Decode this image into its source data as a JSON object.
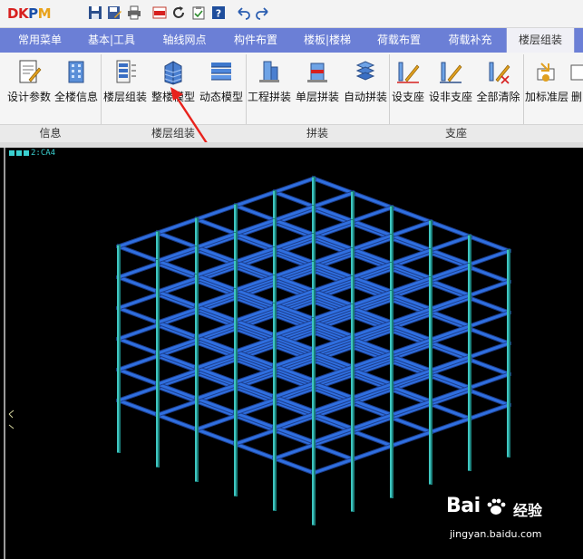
{
  "app": {
    "logo_text": [
      "DK",
      "P",
      "M"
    ],
    "quick_access": [
      "save-icon",
      "save-as-icon",
      "print-icon",
      "dwg-icon",
      "refresh-icon",
      "clipboard-icon",
      "help-icon",
      "undo-icon",
      "redo-icon"
    ]
  },
  "tabs": [
    {
      "label": "常用菜单",
      "active": false
    },
    {
      "label": "基本|工具",
      "active": false
    },
    {
      "label": "轴线网点",
      "active": false
    },
    {
      "label": "构件布置",
      "active": false
    },
    {
      "label": "楼板|楼梯",
      "active": false
    },
    {
      "label": "荷载布置",
      "active": false
    },
    {
      "label": "荷载补充",
      "active": false
    },
    {
      "label": "楼层组装",
      "active": true
    }
  ],
  "ribbon": {
    "buttons": [
      {
        "label": "设计参数",
        "icon": "design-params-icon"
      },
      {
        "label": "全楼信息",
        "icon": "building-info-icon"
      },
      {
        "label": "楼层组装",
        "icon": "floor-assembly-icon"
      },
      {
        "label": "整楼模型",
        "icon": "whole-building-model-icon"
      },
      {
        "label": "动态模型",
        "icon": "dynamic-model-icon"
      },
      {
        "label": "工程拼装",
        "icon": "project-splice-icon"
      },
      {
        "label": "单层拼装",
        "icon": "single-floor-splice-icon"
      },
      {
        "label": "自动拼装",
        "icon": "auto-splice-icon"
      },
      {
        "label": "设支座",
        "icon": "set-support-icon"
      },
      {
        "label": "设非支座",
        "icon": "set-non-support-icon"
      },
      {
        "label": "全部清除",
        "icon": "clear-all-icon"
      },
      {
        "label": "加标准层",
        "icon": "add-standard-floor-icon"
      },
      {
        "label": "删",
        "icon": "delete-icon"
      }
    ],
    "groups": [
      "信息",
      "楼层组装",
      "拼装",
      "支座"
    ]
  },
  "canvas": {
    "layer_label": "2:CA4",
    "background": "#000000",
    "beam_color": "#2f6fe0",
    "column_color": "#3fc6c0"
  },
  "watermark": {
    "brand": "Bai",
    "brand_suffix": "经验",
    "url": "jingyan.baidu.com"
  },
  "colors": {
    "tab_bar": "#6b7fd6",
    "arrow": "#e8221c"
  }
}
